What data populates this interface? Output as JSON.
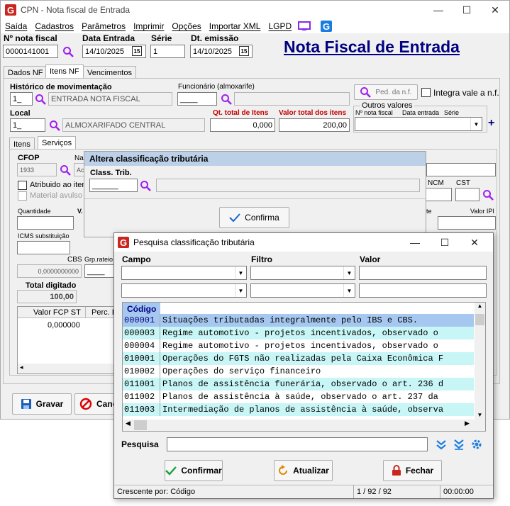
{
  "main": {
    "title": "CPN - Nota fiscal de Entrada",
    "menu": [
      "Saída",
      "Cadastros",
      "Parâmetros",
      "Imprimir",
      "Opções",
      "Importar XML",
      "LGPD"
    ],
    "header_title": "Nota Fiscal de Entrada",
    "nota_fiscal_label": "Nº nota fiscal",
    "nota_fiscal_value": "0000141001",
    "data_entrada_label": "Data Entrada",
    "data_entrada_value": "14/10/2025",
    "serie_label": "Série",
    "serie_value": "1",
    "dt_emissao_label": "Dt. emissão",
    "dt_emissao_value": "14/10/2025",
    "cal_icon_text": "15",
    "tabs": [
      "Dados NF",
      "Itens NF",
      "Vencimentos"
    ],
    "historico_label": "Histórico de movimentação",
    "historico_code": "1_",
    "historico_desc": "ENTRADA NOTA FISCAL",
    "funcionario_label": "Funcionário (almoxarife)",
    "funcionario_code": "____",
    "ped_nf_label": "Ped. da n.f.",
    "integra_label": "Integra vale a n.f.",
    "outros_valores_label": "Outros valores",
    "ov_cols": [
      "Nº nota fiscal",
      "Data entrada",
      "Série"
    ],
    "local_label": "Local",
    "local_code": "1_",
    "local_desc": "ALMOXARIFADO CENTRAL",
    "qt_total_label": "Qt. total de Itens",
    "qt_total_value": "0,000",
    "valor_total_label": "Valor total dos itens",
    "valor_total_value": "200,00",
    "subtabs": [
      "Itens",
      "Serviços"
    ],
    "cfop_label": "CFOP",
    "cfop_value": "1933",
    "na_label": "Na",
    "ac_value": "Ac",
    "atribuido_label": "Atribuido ao iten",
    "material_label": "Material avulso",
    "ncm_label": "NCM",
    "cst_label": "CST",
    "quantidade_label": "Quantidade",
    "v_label": "V.",
    "te_label": "te",
    "valor_ipi_label": "Valor IPI",
    "icms_sub_label": "ICMS substituição",
    "cbs_label": "CBS",
    "cbs_value": "0,0000000000",
    "grp_rateio_label": "Grp.rateio",
    "grp_rateio_value": "____",
    "total_digitado_label": "Total digitado",
    "total_digitado_value": "100,00",
    "grid_cols": [
      "Valor FCP ST",
      "Perc. I"
    ],
    "grid_value": "0,000000",
    "gravar_label": "Gravar",
    "cancel_label": "Canc"
  },
  "dialog1": {
    "title": "Altera classificação tributária",
    "class_trib_label": "Class. Trib.",
    "class_trib_value": "______",
    "confirma_label": "Confirma"
  },
  "dialog2": {
    "title": "Pesquisa classificação tributária",
    "campo_label": "Campo",
    "filtro_label": "Filtro",
    "valor_label": "Valor",
    "col_codigo": "Código",
    "rows": [
      {
        "code": "000001",
        "desc": "Situações tributadas integralmente pelo IBS e CBS."
      },
      {
        "code": "000003",
        "desc": "Regime automotivo - projetos incentivados, observado o"
      },
      {
        "code": "000004",
        "desc": "Regime automotivo - projetos incentivados, observado o"
      },
      {
        "code": "010001",
        "desc": "Operações do FGTS não realizadas pela Caixa Econômica F"
      },
      {
        "code": "010002",
        "desc": "Operações do serviço financeiro"
      },
      {
        "code": "011001",
        "desc": "Planos de assistência funerária, observado o art. 236 d"
      },
      {
        "code": "011002",
        "desc": "Planos de assistência à saúde, observado o art. 237 da"
      },
      {
        "code": "011003",
        "desc": "Intermediação de planos de assistência à saúde, observa"
      }
    ],
    "pesquisa_label": "Pesquisa",
    "confirmar_label": "Confirmar",
    "atualizar_label": "Atualizar",
    "fechar_label": "Fechar",
    "status_order": "Crescente por: Código",
    "status_count": "1 / 92 / 92",
    "status_time": "00:00:00"
  },
  "colors": {
    "selected_row": "#a6c8f0",
    "cyan_row": "#c8f5f5",
    "white_row": "#ffffff",
    "header_title": "#000080",
    "red_label": "#c00000",
    "accent_icon": "#1a7de0"
  }
}
